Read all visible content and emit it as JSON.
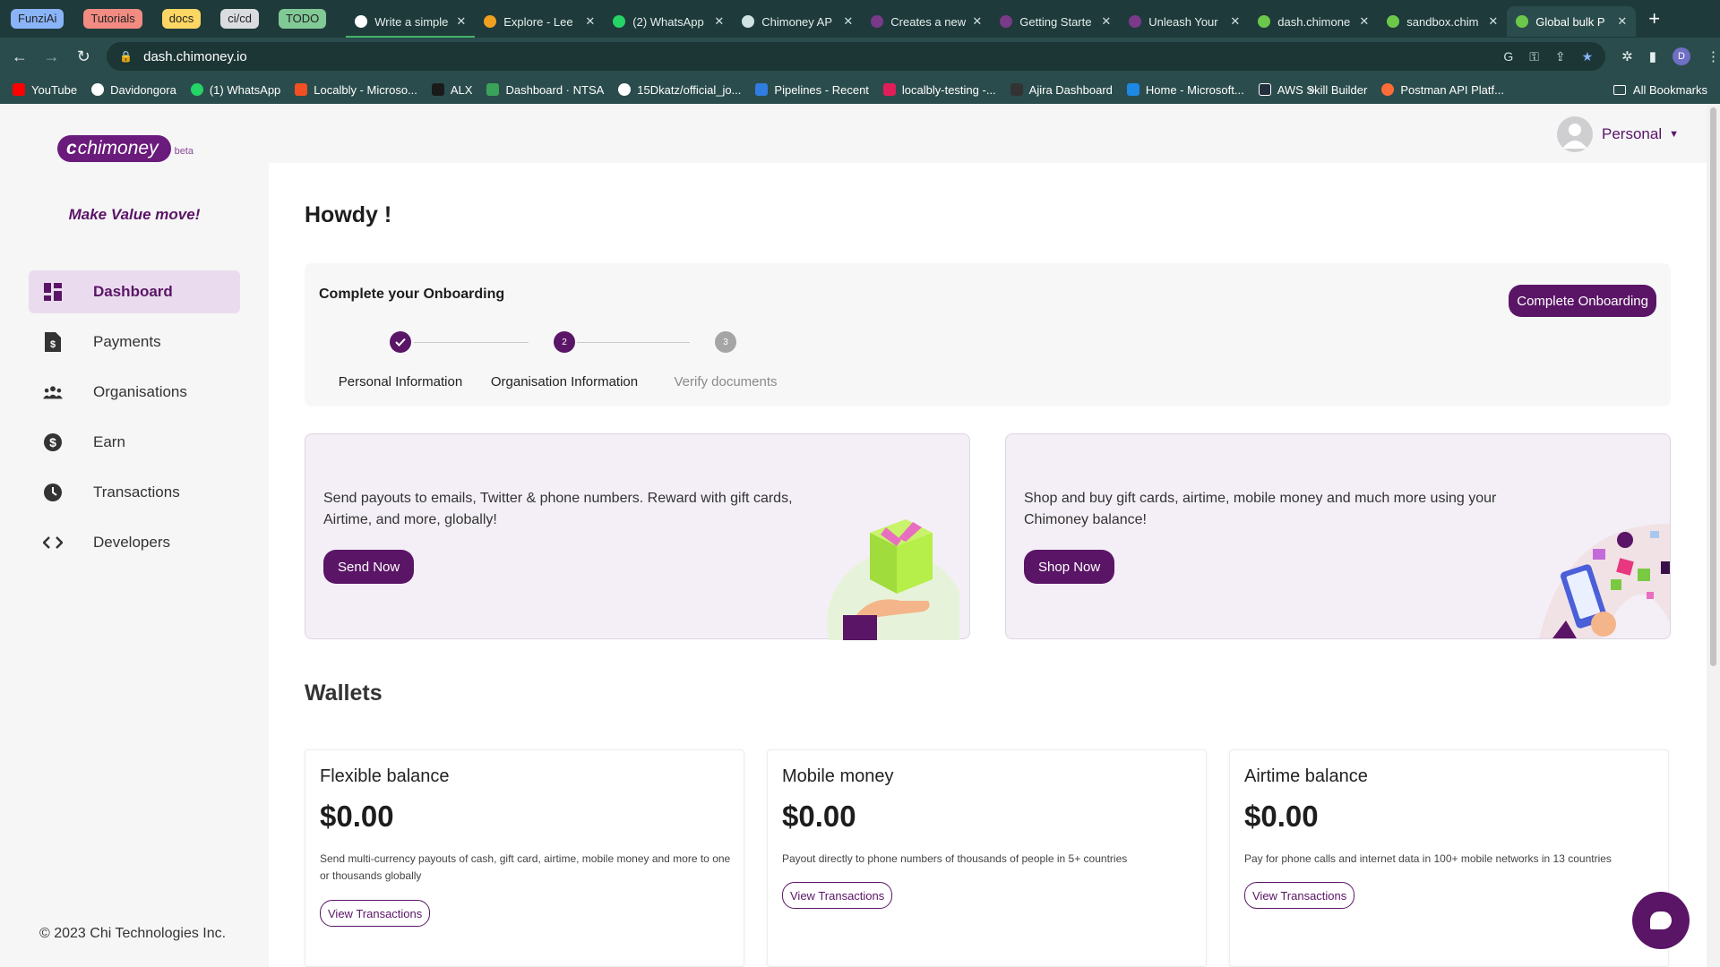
{
  "browser": {
    "tab_groups": [
      {
        "label": "FunziAi",
        "color": "#8ab4f8"
      },
      {
        "label": "Tutorials",
        "color": "#f28b82"
      },
      {
        "label": "docs",
        "color": "#fdd663"
      },
      {
        "label": "ci/cd",
        "color": "#dadce0"
      },
      {
        "label": "TODO",
        "color": "#81c995"
      }
    ],
    "tabs": [
      {
        "title": "Write a simple",
        "favicon": "github-icon",
        "favcolor": "#ffffff",
        "grouped": true
      },
      {
        "title": "Explore - Lee",
        "favicon": "leetcode-icon",
        "favcolor": "#f0a020",
        "grouped": false
      },
      {
        "title": "(2) WhatsApp",
        "favicon": "whatsapp-icon",
        "favcolor": "#25d366",
        "grouped": false
      },
      {
        "title": "Chimoney AP",
        "favicon": "chatgpt-icon",
        "favcolor": "#cfe3e3",
        "grouped": false
      },
      {
        "title": "Creates a new",
        "favicon": "chimoney-icon",
        "favcolor": "#7a3a8a",
        "grouped": false
      },
      {
        "title": "Getting Starte",
        "favicon": "chimoney-icon",
        "favcolor": "#7a3a8a",
        "grouped": false
      },
      {
        "title": "Unleash Your",
        "favicon": "chimoney-icon",
        "favcolor": "#7a3a8a",
        "grouped": false
      },
      {
        "title": "dash.chimone",
        "favicon": "chimoney-icon",
        "favcolor": "#6bc84a",
        "grouped": false
      },
      {
        "title": "sandbox.chim",
        "favicon": "chimoney-icon",
        "favcolor": "#6bc84a",
        "grouped": false
      },
      {
        "title": "Global bulk P",
        "favicon": "chimoney-icon",
        "favcolor": "#6bc84a",
        "grouped": false,
        "active": true
      }
    ],
    "url": "dash.chimoney.io",
    "profile_initial": "D",
    "bookmarks": [
      {
        "label": "YouTube",
        "color": "#ff0000"
      },
      {
        "label": "Davidongora",
        "color": "#ffffff"
      },
      {
        "label": "(1) WhatsApp",
        "color": "#25d366"
      },
      {
        "label": "Localbly - Microso...",
        "color": "#f25022"
      },
      {
        "label": "ALX",
        "color": "#1a1a1a"
      },
      {
        "label": "Dashboard · NTSA",
        "color": "#3aa35a"
      },
      {
        "label": "15Dkatz/official_jo...",
        "color": "#ffffff"
      },
      {
        "label": "Pipelines - Recent",
        "color": "#2f7de1"
      },
      {
        "label": "localbly-testing -...",
        "color": "#e01e5a"
      },
      {
        "label": "Ajira Dashboard",
        "color": "#333333"
      },
      {
        "label": "Home - Microsoft...",
        "color": "#1e88e5"
      },
      {
        "label": "AWS Skill Builder",
        "color": "#232f3e"
      },
      {
        "label": "Postman API Platf...",
        "color": "#ff6c37"
      }
    ],
    "bookmarks_more": "»",
    "all_bookmarks": "All Bookmarks"
  },
  "app": {
    "logo_text": "chimoney",
    "logo_mark": "c",
    "logo_badge": "beta",
    "tagline": "Make Value move!",
    "nav": [
      {
        "label": "Dashboard",
        "icon": "dashboard-icon",
        "active": true
      },
      {
        "label": "Payments",
        "icon": "payments-icon"
      },
      {
        "label": "Organisations",
        "icon": "organisations-icon"
      },
      {
        "label": "Earn",
        "icon": "dollar-icon"
      },
      {
        "label": "Transactions",
        "icon": "clock-icon"
      },
      {
        "label": "Developers",
        "icon": "code-icon"
      }
    ],
    "copyright": "© 2023 Chi Technologies Inc.",
    "profile_label": "Personal",
    "brand_color": "#5a1566"
  },
  "main": {
    "greeting": "Howdy !",
    "onboarding": {
      "title": "Complete your Onboarding",
      "button": "Complete Onboarding",
      "steps": [
        {
          "number": "1",
          "label": "Personal Information",
          "state": "done"
        },
        {
          "number": "2",
          "label": "Organisation Information",
          "state": "current"
        },
        {
          "number": "3",
          "label": "Verify documents",
          "state": "pending"
        }
      ]
    },
    "promos": [
      {
        "text": "Send payouts to emails, Twitter & phone numbers. Reward with gift cards, Airtime, and more, globally!",
        "button": "Send Now"
      },
      {
        "text": "Shop and buy gift cards, airtime, mobile money and much more using your Chimoney balance!",
        "button": "Shop Now"
      }
    ],
    "wallets_title": "Wallets",
    "wallets": [
      {
        "title": "Flexible balance",
        "amount": "$0.00",
        "description": "Send multi-currency payouts of cash, gift card, airtime, mobile money and more to one or thousands globally",
        "button": "View Transactions"
      },
      {
        "title": "Mobile money",
        "amount": "$0.00",
        "description": "Payout directly to phone numbers of thousands of people in 5+ countries",
        "button": "View Transactions"
      },
      {
        "title": "Airtime balance",
        "amount": "$0.00",
        "description": "Pay for phone calls and internet data in 100+ mobile networks in 13 countries",
        "button": "View Transactions"
      }
    ]
  }
}
